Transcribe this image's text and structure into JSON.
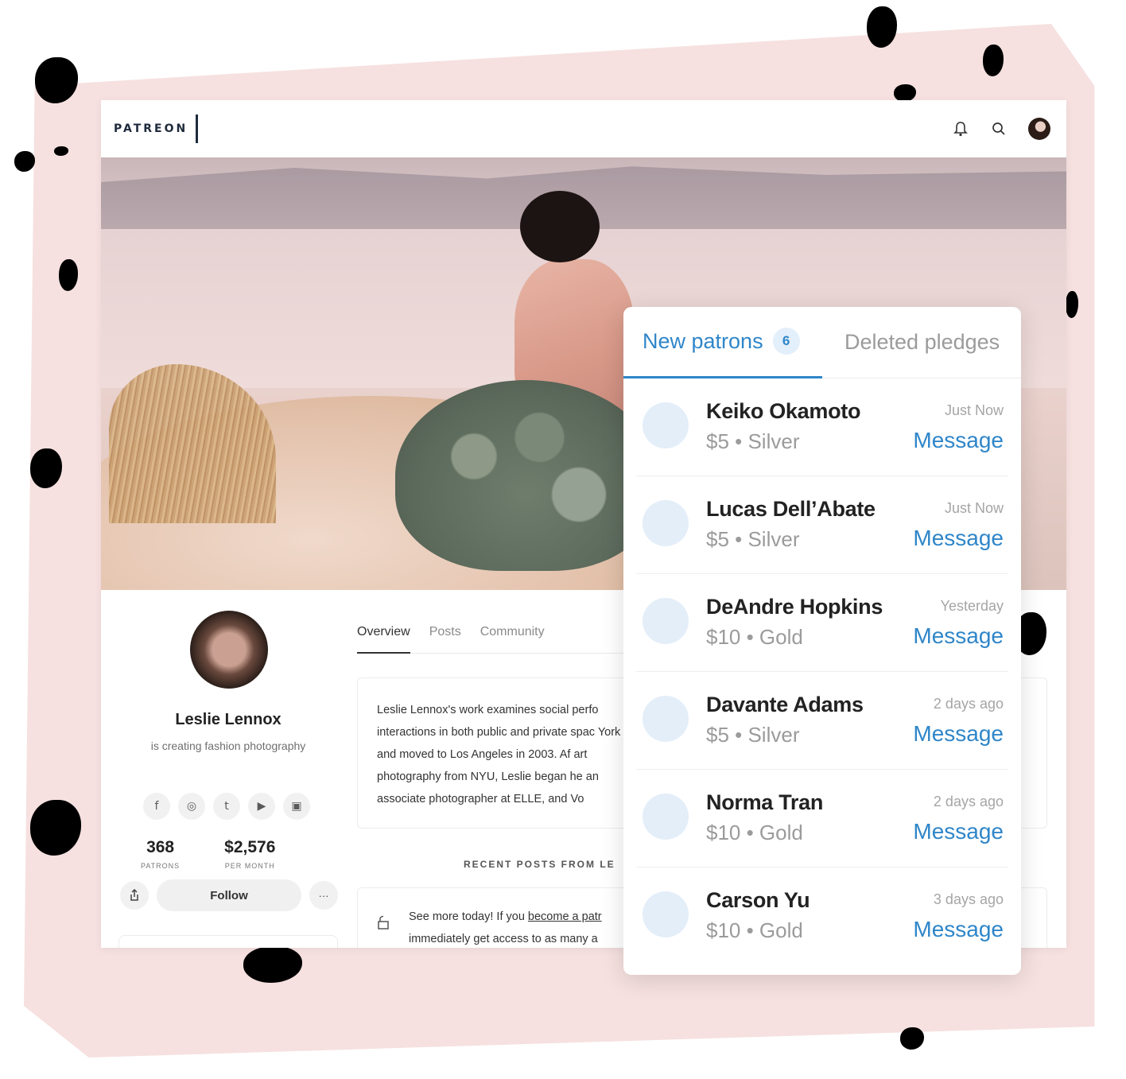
{
  "brand": {
    "logo_text": "PATREON"
  },
  "header": {
    "icons": [
      "bell-icon",
      "search-icon",
      "avatar"
    ]
  },
  "profile": {
    "name": "Leslie Lennox",
    "tagline": "is creating fashion photography",
    "socials": [
      "f",
      "◎",
      "t",
      "▶",
      "▣"
    ],
    "stats": [
      {
        "value": "368",
        "label": "PATRONS"
      },
      {
        "value": "$2,576",
        "label": "PER MONTH"
      }
    ],
    "follow_label": "Follow",
    "more_label": "···"
  },
  "main": {
    "tabs": [
      "Overview",
      "Posts",
      "Community"
    ],
    "about": "Leslie Lennox's work examines social perfo interactions in both public and private spac York and moved to Los Angeles in 2003. Af art photography from NYU, Leslie began he an associate photographer at ELLE, and Vo",
    "recent_label": "RECENT POSTS FROM LE",
    "post": {
      "prefix": "See more today! If you ",
      "link": "become a patr",
      "suffix": " immediately get access to as many a"
    }
  },
  "panel": {
    "tab_new": "New patrons",
    "new_count": "6",
    "tab_deleted": "Deleted pledges",
    "patrons": [
      {
        "name": "Keiko Okamoto",
        "tier": "$5 • Silver",
        "time": "Just Now",
        "action": "Message"
      },
      {
        "name": "Lucas Dell’Abate",
        "tier": "$5 • Silver",
        "time": "Just Now",
        "action": "Message"
      },
      {
        "name": "DeAndre Hopkins",
        "tier": "$10 • Gold",
        "time": "Yesterday",
        "action": "Message"
      },
      {
        "name": "Davante Adams",
        "tier": "$5 • Silver",
        "time": "2 days ago",
        "action": "Message"
      },
      {
        "name": "Norma Tran",
        "tier": "$10 • Gold",
        "time": "2 days ago",
        "action": "Message"
      },
      {
        "name": "Carson Yu",
        "tier": "$10 • Gold",
        "time": "3 days ago",
        "action": "Message"
      }
    ]
  },
  "colors": {
    "accent": "#2f86c9",
    "background_card": "#f6e1e0",
    "badge_bg": "#e3effa"
  }
}
